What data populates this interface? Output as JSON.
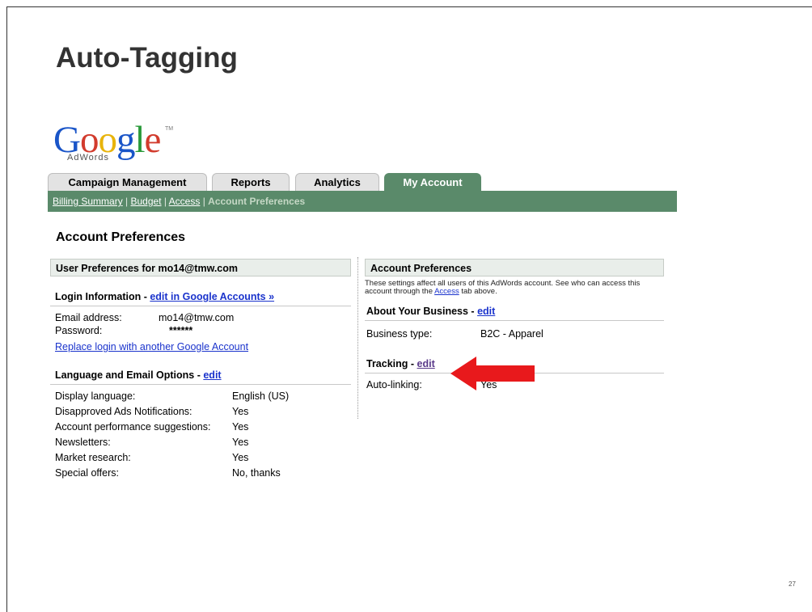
{
  "slide": {
    "title": "Auto-Tagging",
    "page_number": "27"
  },
  "logo": {
    "word": "Google",
    "sub": "AdWords",
    "tm": "TM"
  },
  "tabs": [
    {
      "label": "Campaign Management"
    },
    {
      "label": "Reports"
    },
    {
      "label": "Analytics"
    },
    {
      "label": "My Account"
    }
  ],
  "subnav": {
    "items": [
      "Billing Summary",
      "Budget",
      "Access"
    ],
    "separator": " | ",
    "current": "Account Preferences"
  },
  "page_heading": "Account Preferences",
  "left": {
    "header": "User Preferences for mo14@tmw.com",
    "login": {
      "title": "Login Information - ",
      "edit_label": "edit in Google Accounts »",
      "email_key": "Email address:",
      "email_val": "mo14@tmw.com",
      "password_key": "Password:",
      "password_val": "******",
      "replace_link": "Replace login with another Google Account"
    },
    "language": {
      "title": "Language and Email Options - ",
      "edit_label": "edit",
      "rows": [
        {
          "k": "Display language:",
          "v": "English (US)"
        },
        {
          "k": "Disapproved Ads Notifications:",
          "v": "Yes"
        },
        {
          "k": "Account performance suggestions:",
          "v": "Yes"
        },
        {
          "k": "Newsletters:",
          "v": "Yes"
        },
        {
          "k": "Market research:",
          "v": "Yes"
        },
        {
          "k": "Special offers:",
          "v": "No, thanks"
        }
      ]
    }
  },
  "right": {
    "header": "Account Preferences",
    "note_before": "These settings affect all users of this AdWords account. See who can access this account through the ",
    "note_link": "Access",
    "note_after": " tab above.",
    "business": {
      "title": "About Your Business - ",
      "edit_label": "edit",
      "key": "Business type:",
      "val": "B2C - Apparel"
    },
    "tracking": {
      "title": "Tracking - ",
      "edit_label": "edit",
      "key": "Auto-linking:",
      "val": "Yes"
    }
  },
  "colors": {
    "accent": "#5a8a6a",
    "arrow": "#e8191c",
    "link": "#1a33cc"
  }
}
